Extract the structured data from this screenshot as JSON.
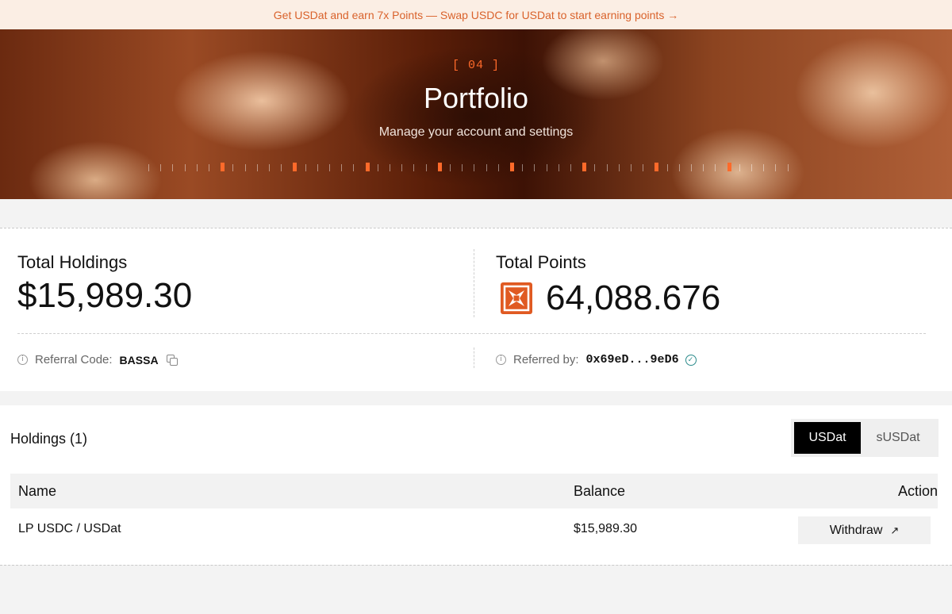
{
  "banner": {
    "text": "Get USDat and earn 7x Points — Swap USDC for USDat to start earning points →"
  },
  "hero": {
    "section_number": "[ 04 ]",
    "title": "Portfolio",
    "subtitle": "Manage your account and settings",
    "accent_color": "#ff6a2a"
  },
  "summary": {
    "total_holdings_label": "Total Holdings",
    "total_holdings_value": "$15,989.30",
    "total_points_label": "Total Points",
    "total_points_value": "64,088.676",
    "referral_code_label": "Referral Code:",
    "referral_code_value": "BASSA",
    "referred_by_label": "Referred by:",
    "referred_by_value": "0x69eD...9eD6"
  },
  "holdings": {
    "title": "Holdings (1)",
    "toggle": {
      "options": [
        "USDat",
        "sUSDat"
      ],
      "selected": "USDat"
    },
    "columns": [
      "Name",
      "Balance",
      "Action"
    ],
    "rows": [
      {
        "name": "LP USDC / USDat",
        "balance": "$15,989.30",
        "action": "Withdraw"
      }
    ]
  },
  "icons": {
    "info": "info-icon",
    "copy": "copy-icon",
    "verified": "check-circle-icon",
    "points": "points-logo-icon",
    "withdraw_arrow": "arrow-up-right-icon"
  }
}
